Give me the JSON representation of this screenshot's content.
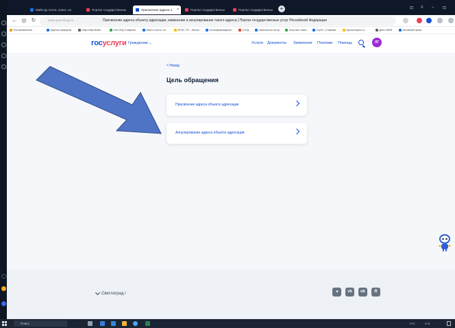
{
  "browser": {
    "tabs": [
      {
        "label": "Майл.ру почта, поиск, но"
      },
      {
        "label": "Портал государственны"
      },
      {
        "label": "Присвоение адреса о"
      },
      {
        "label": "Портал государственны"
      },
      {
        "label": "Портал государственны"
      }
    ],
    "active_tab_index": 2,
    "new_tab_glyph": "+",
    "window_controls": [
      "⊡",
      "≡",
      "–",
      "⊡"
    ],
    "url": "www.gosuslugi.ru",
    "page_title": "Присвоение адреса объекту адресации, изменение и аннулирование такого адреса | Портал государственных услуг Российской Федерации",
    "bookmarks": [
      {
        "label": "Постановление ..",
        "color": "#f29c1f"
      },
      {
        "label": "Единая информа",
        "color": "#1a73e8"
      },
      {
        "label": "https://fias-ftrials",
        "color": "#5f6368"
      },
      {
        "label": "ГИСОГД Ставропо",
        "color": "#34a853"
      },
      {
        "label": "Mail.ru почта, по",
        "color": "#1a73e8"
      },
      {
        "label": "ФГИС ТП - Личны",
        "color": "#fbbc04"
      },
      {
        "label": "Геоинформационн",
        "color": "#1a73e8"
      },
      {
        "label": "СОГД",
        "color": "#ea4335"
      },
      {
        "label": "Записаться на пр",
        "color": "#1a73e8"
      },
      {
        "label": "Хочу все знать",
        "color": "#34a853"
      },
      {
        "label": "СЦОС | Главная",
        "color": "#1a73e8"
      },
      {
        "label": "Бухгалтерия 1с",
        "color": "#fbbc04"
      },
      {
        "label": "Дело WEB",
        "color": "#5f6368"
      },
      {
        "label": "Активный грачи",
        "color": "#1a73e8"
      }
    ]
  },
  "site": {
    "logo_part1": "гос",
    "logo_part2": "услуги",
    "segment": "Гражданам ⌄",
    "nav": [
      "Услуги",
      "Документы",
      "Заявления",
      "Платежи",
      "Помощь"
    ],
    "avatar_initials": "ЛГ"
  },
  "main": {
    "back": "< Назад",
    "title": "Цель обращения",
    "options": [
      {
        "label": "Присвоение адреса объекту адресации"
      },
      {
        "label": "Аннулирование адреса объекта адресации"
      }
    ]
  },
  "footer": {
    "location": "Светлоград г",
    "social": [
      "◂",
      "vk",
      "ok",
      "R"
    ]
  },
  "taskbar": {
    "search_placeholder": "Поиск",
    "tray_text": "РУС",
    "time": "9:31"
  },
  "colors": {
    "accent": "#0d4cd3",
    "logo_red": "#ee3f58",
    "arrow_fill": "#4f74c6"
  }
}
